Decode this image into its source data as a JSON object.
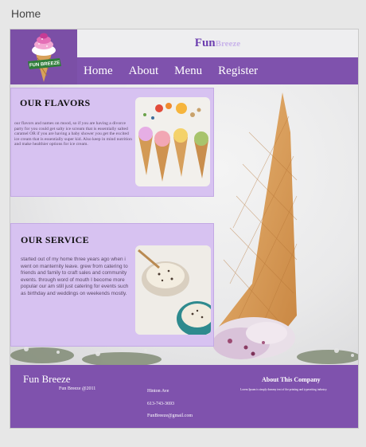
{
  "window": {
    "title": "Home"
  },
  "brand": {
    "fun": "Fun",
    "breeze": "Breeze",
    "logo_text": "FUN BREEZE"
  },
  "nav": {
    "items": [
      "Home",
      "About",
      "Menu",
      "Register"
    ]
  },
  "flavors": {
    "title": "OUR FLAVORS",
    "text": "our flavors and names on mood, so if you are having a divorce party for you could get salty ice scream that is essentially salted caramel OR if you are having a baby shower you get the excited ice cream that is essentially super kid. Also keep in mind nutrition and make healthier options for ice cream."
  },
  "service": {
    "title": "OUR SERVICE",
    "text": "started out of my home three years ago when i went on manternity leave. grew from catering to friends and family to craft sales and community events. through word of mouth I become more popular our am still just catering for events such as birthday and weddings on weekends mostly."
  },
  "footer": {
    "brand": "Fun Breeze",
    "copyright": "Fun Breeze @2011",
    "address": "Hinton Ave",
    "phone": "613-743-3693",
    "email": "FunBreeze@gmail.com",
    "about_title": "About This Company",
    "about_text": "Lorem Ipsum is simply dummy text of the printing and typesetting industry."
  },
  "colors": {
    "purple": "#7f52ad",
    "lavender": "#d7c2f1",
    "brand_purple": "#6d3fb0",
    "brand_light": "#c9b4ea"
  }
}
